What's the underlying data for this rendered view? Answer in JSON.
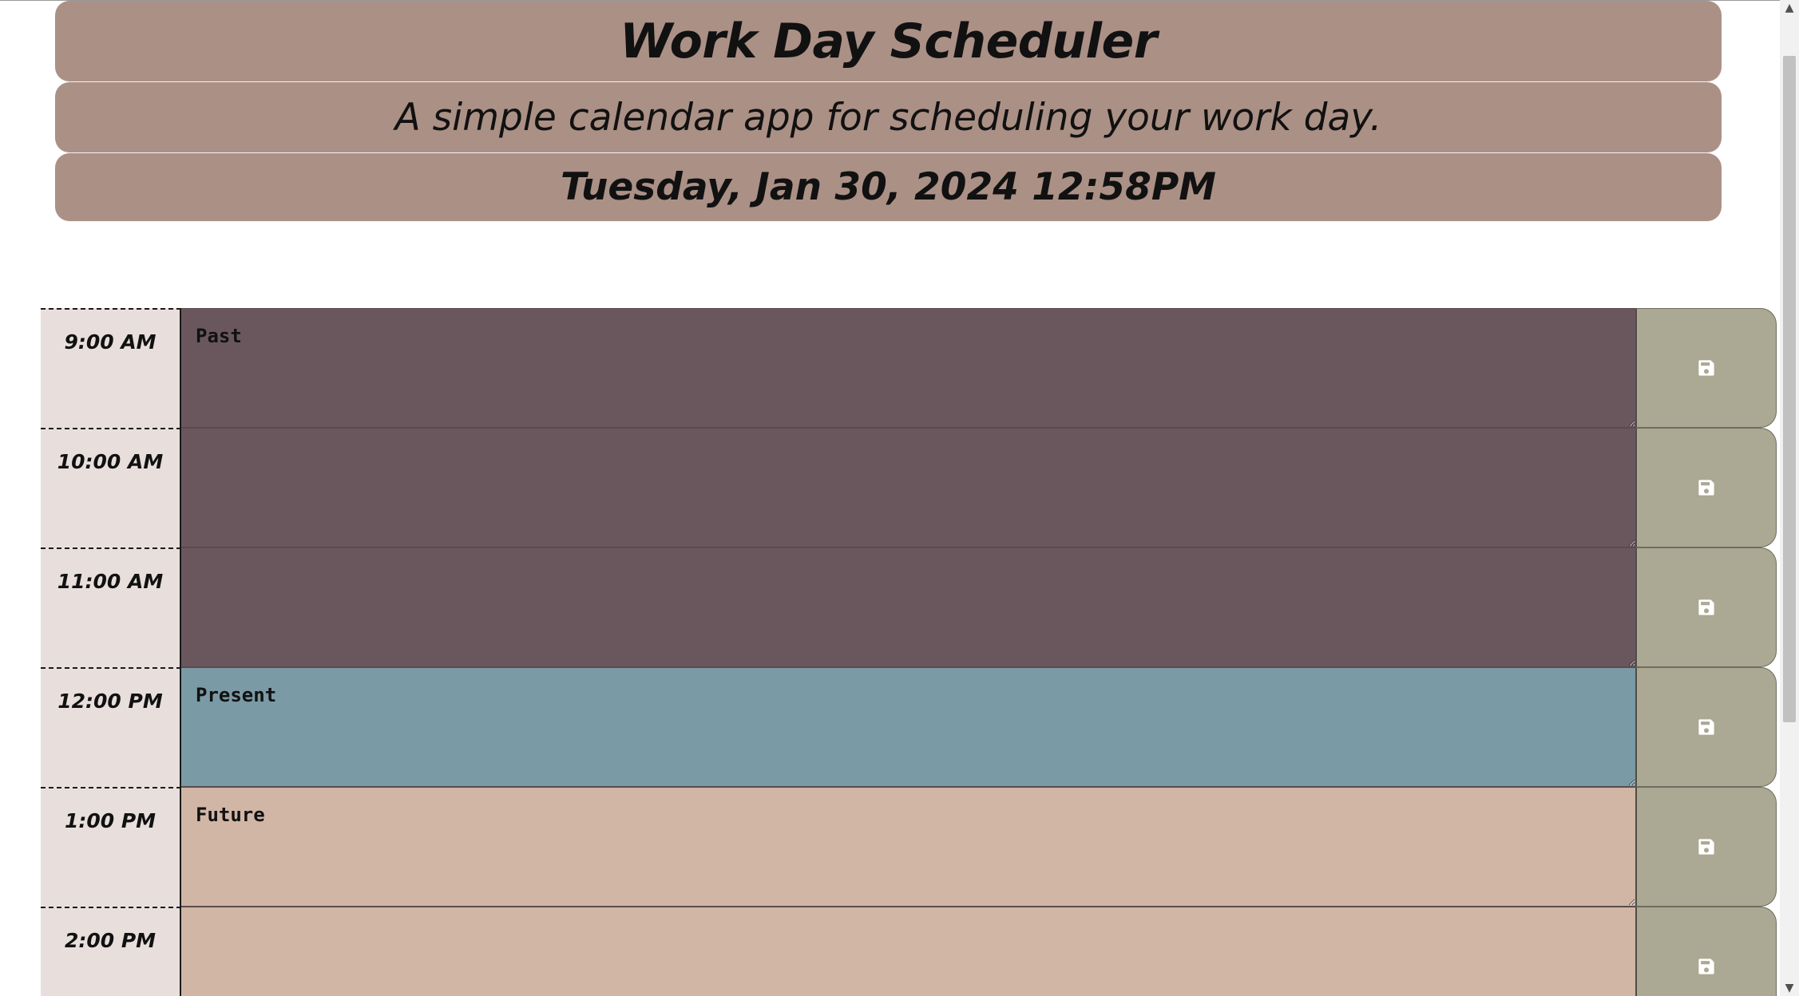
{
  "header": {
    "title": "Work Day Scheduler",
    "subtitle": "A simple calendar app for scheduling your work day.",
    "current_date": "Tuesday, Jan 30, 2024 12:58PM"
  },
  "colors": {
    "header_bg": "#ab9086",
    "hour_bg": "#e8dfdd",
    "past": "#6a575e",
    "present": "#7a9aa5",
    "future": "#d1b6a6",
    "save_button": "#aba893",
    "save_icon": "#ffffff"
  },
  "timeblocks": [
    {
      "hour": "9:00 AM",
      "state": "past",
      "text": "Past"
    },
    {
      "hour": "10:00 AM",
      "state": "past",
      "text": ""
    },
    {
      "hour": "11:00 AM",
      "state": "past",
      "text": ""
    },
    {
      "hour": "12:00 PM",
      "state": "present",
      "text": "Present"
    },
    {
      "hour": "1:00 PM",
      "state": "future",
      "text": "Future"
    },
    {
      "hour": "2:00 PM",
      "state": "future",
      "text": ""
    }
  ],
  "icons": {
    "save": "floppy-disk-icon",
    "scroll_up": "chevron-up-icon",
    "scroll_down": "chevron-down-icon"
  }
}
